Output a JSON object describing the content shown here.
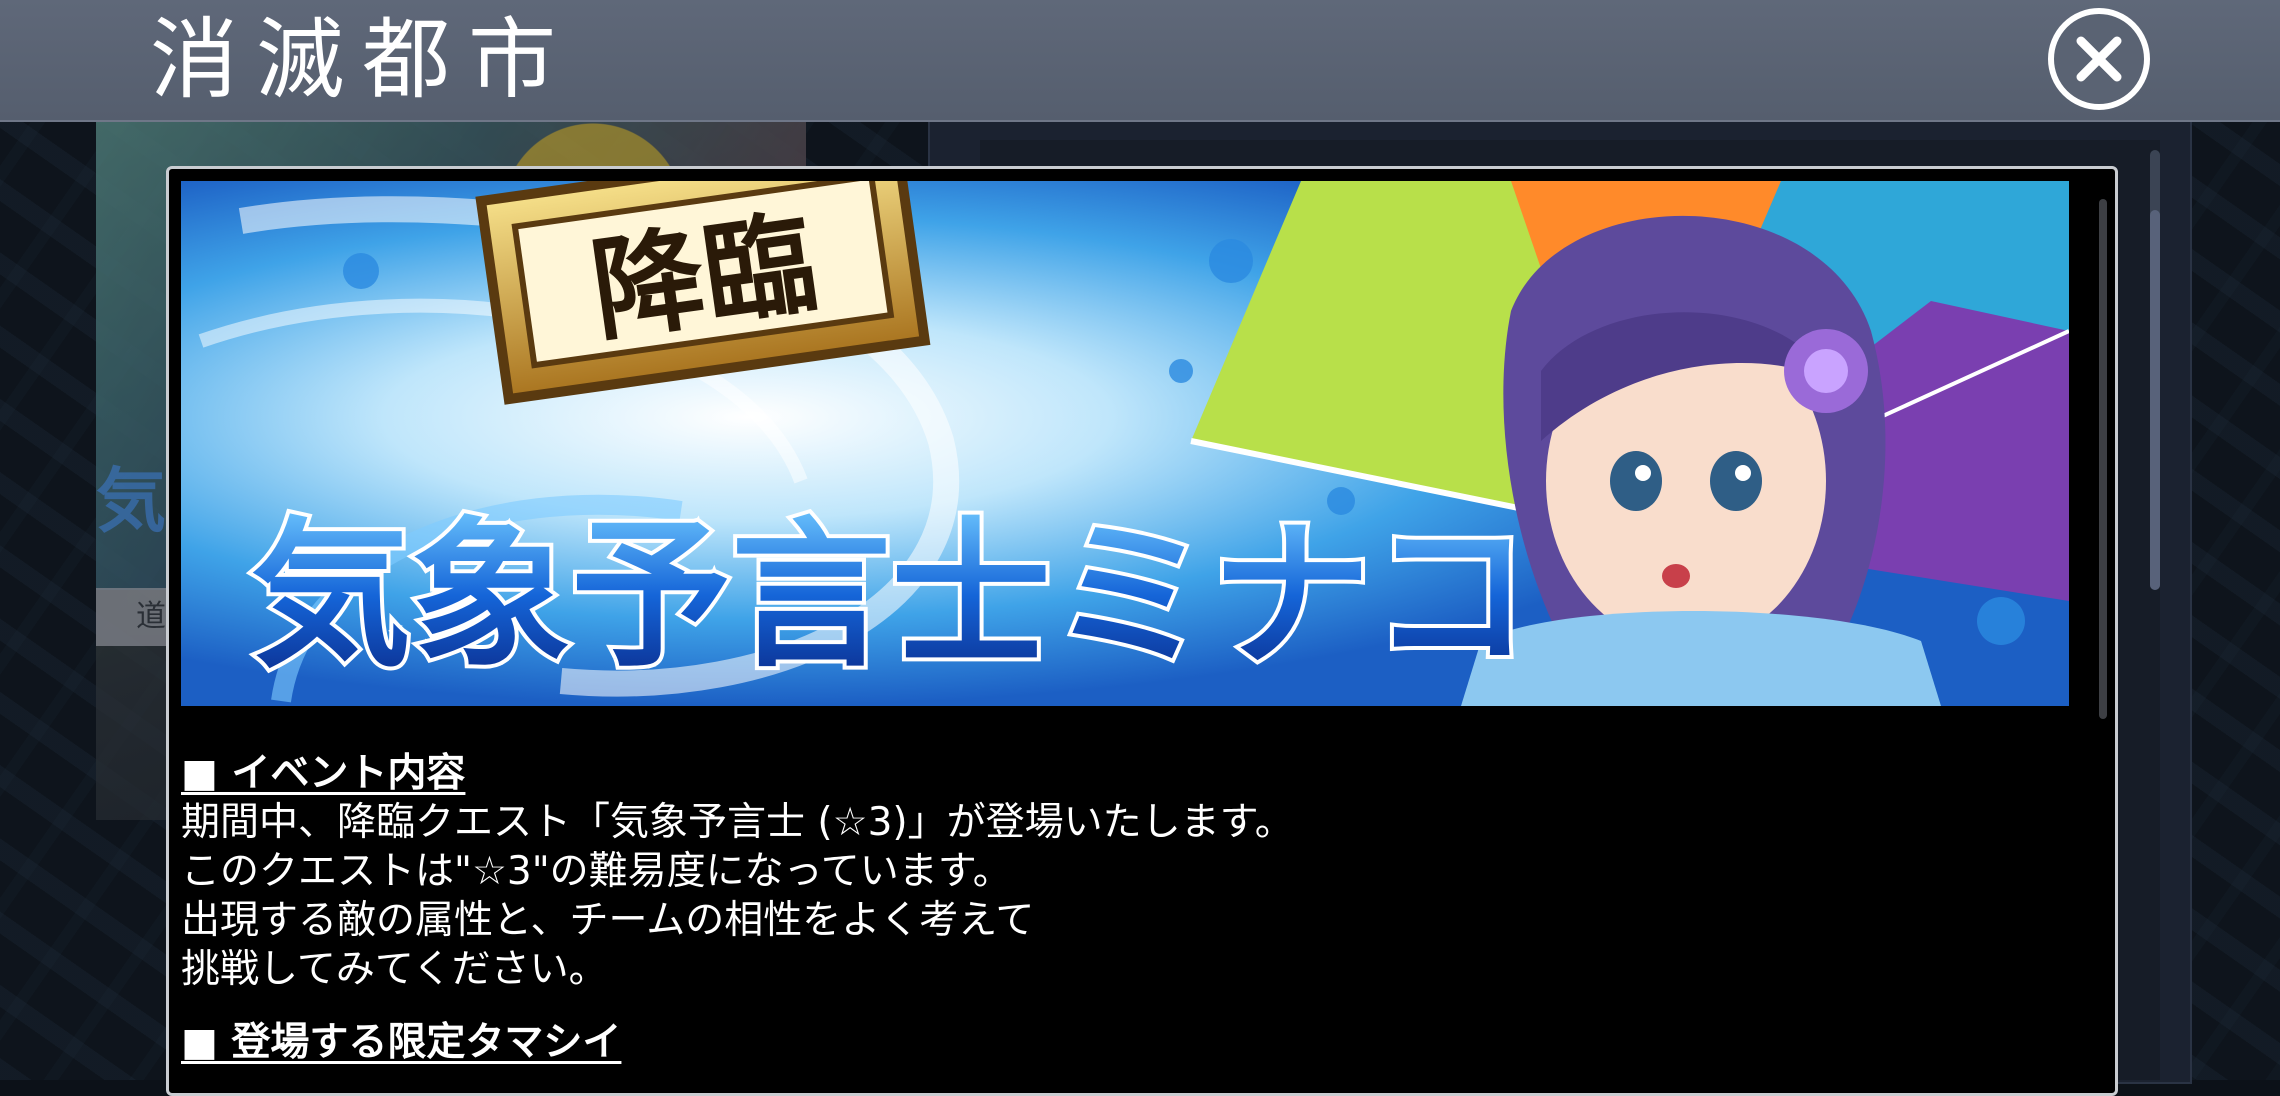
{
  "header": {
    "title": "消滅都市"
  },
  "background": {
    "left_card_text": "気",
    "left_tab_label": "道"
  },
  "banner": {
    "badge_text": "降臨",
    "title_text": "気象予言士ミナコ"
  },
  "notice": {
    "sections": [
      {
        "heading": "■ イベント内容",
        "lines": [
          "期間中、降臨クエスト「気象予言士 (☆3)」が登場いたします。",
          "このクエストは\"☆3\"の難易度になっています。",
          "出現する敵の属性と、チームの相性をよく考えて",
          "挑戦してみてください。"
        ]
      },
      {
        "heading": "■ 登場する限定タマシイ"
      }
    ]
  },
  "icons": {
    "close": "close-icon"
  },
  "colors": {
    "header_bg": "#5a6373",
    "modal_bg": "#000000",
    "modal_border": "#c9ccd1",
    "text": "#ffffff"
  }
}
